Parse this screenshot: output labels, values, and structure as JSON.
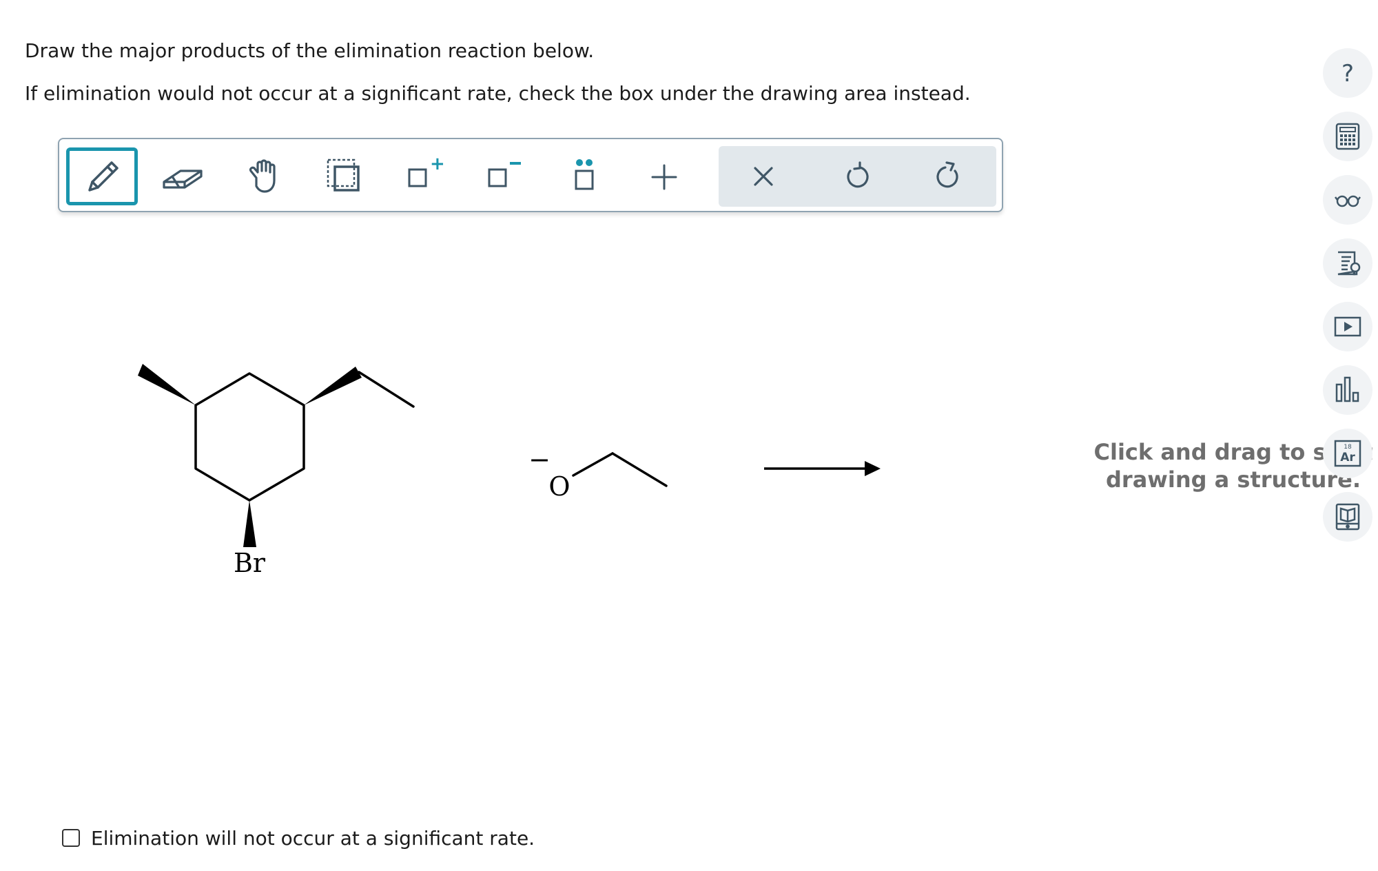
{
  "question": {
    "line1": "Draw the major products of the elimination reaction below.",
    "line2": "If elimination would not occur at a significant rate, check the box under the drawing area instead."
  },
  "toolbar": {
    "tools": [
      {
        "name": "pencil-icon",
        "active": true
      },
      {
        "name": "eraser-icon",
        "active": false
      },
      {
        "name": "hand-icon",
        "active": false
      },
      {
        "name": "select-box-icon",
        "active": false
      },
      {
        "name": "increase-charge-icon",
        "active": false
      },
      {
        "name": "decrease-charge-icon",
        "active": false
      },
      {
        "name": "lone-pair-icon",
        "active": false
      },
      {
        "name": "add-icon",
        "active": false
      },
      {
        "name": "clear-icon",
        "active": false
      },
      {
        "name": "undo-icon",
        "active": false
      },
      {
        "name": "redo-icon",
        "active": false
      }
    ],
    "charge_plus": "+",
    "charge_minus": "−"
  },
  "reaction": {
    "substituent_label": "Br",
    "nucleophile_atom": "O",
    "nucleophile_charge": "−"
  },
  "canvas": {
    "hint_line1": "Click and drag to start",
    "hint_line2": "drawing a structure."
  },
  "sidebar": {
    "help_symbol": "?",
    "periodic_mass": "18",
    "periodic_symbol": "Ar",
    "buttons": [
      "help-icon",
      "calculator-icon",
      "glasses-icon",
      "reference-icon",
      "video-icon",
      "bar-chart-icon",
      "periodic-table-icon",
      "textbook-icon"
    ]
  },
  "checkbox": {
    "label": "Elimination will not occur at a significant rate.",
    "checked": false
  },
  "colors": {
    "accent": "#1a95ad",
    "icon": "#3f5666",
    "toolbar_group_bg": "#e2e8ec",
    "hint_text": "#6e6e6e"
  }
}
